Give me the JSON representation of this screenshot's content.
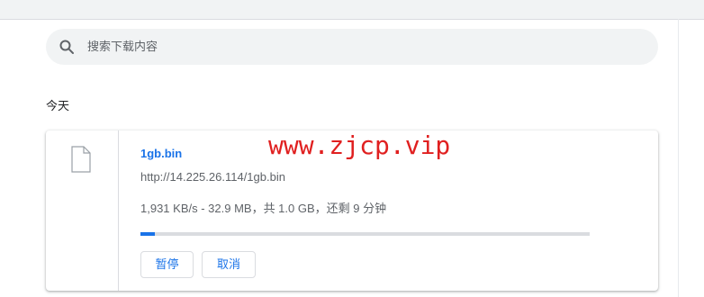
{
  "search": {
    "placeholder": "搜索下载内容",
    "icon": "search-icon"
  },
  "section": {
    "date_label": "今天"
  },
  "download": {
    "file_name": "1gb.bin",
    "url": "http://14.225.26.114/1gb.bin",
    "status": "1,931 KB/s - 32.9 MB，共 1.0 GB，还剩 9 分钟",
    "progress_percent": 3.2,
    "file_icon": "file-icon",
    "pause_label": "暂停",
    "cancel_label": "取消"
  },
  "watermark": {
    "text": "www.zjcp.vip"
  },
  "colors": {
    "accent": "#1a73e8",
    "watermark": "#e02020",
    "track": "#dadce0",
    "search_bg": "#f1f3f4"
  }
}
